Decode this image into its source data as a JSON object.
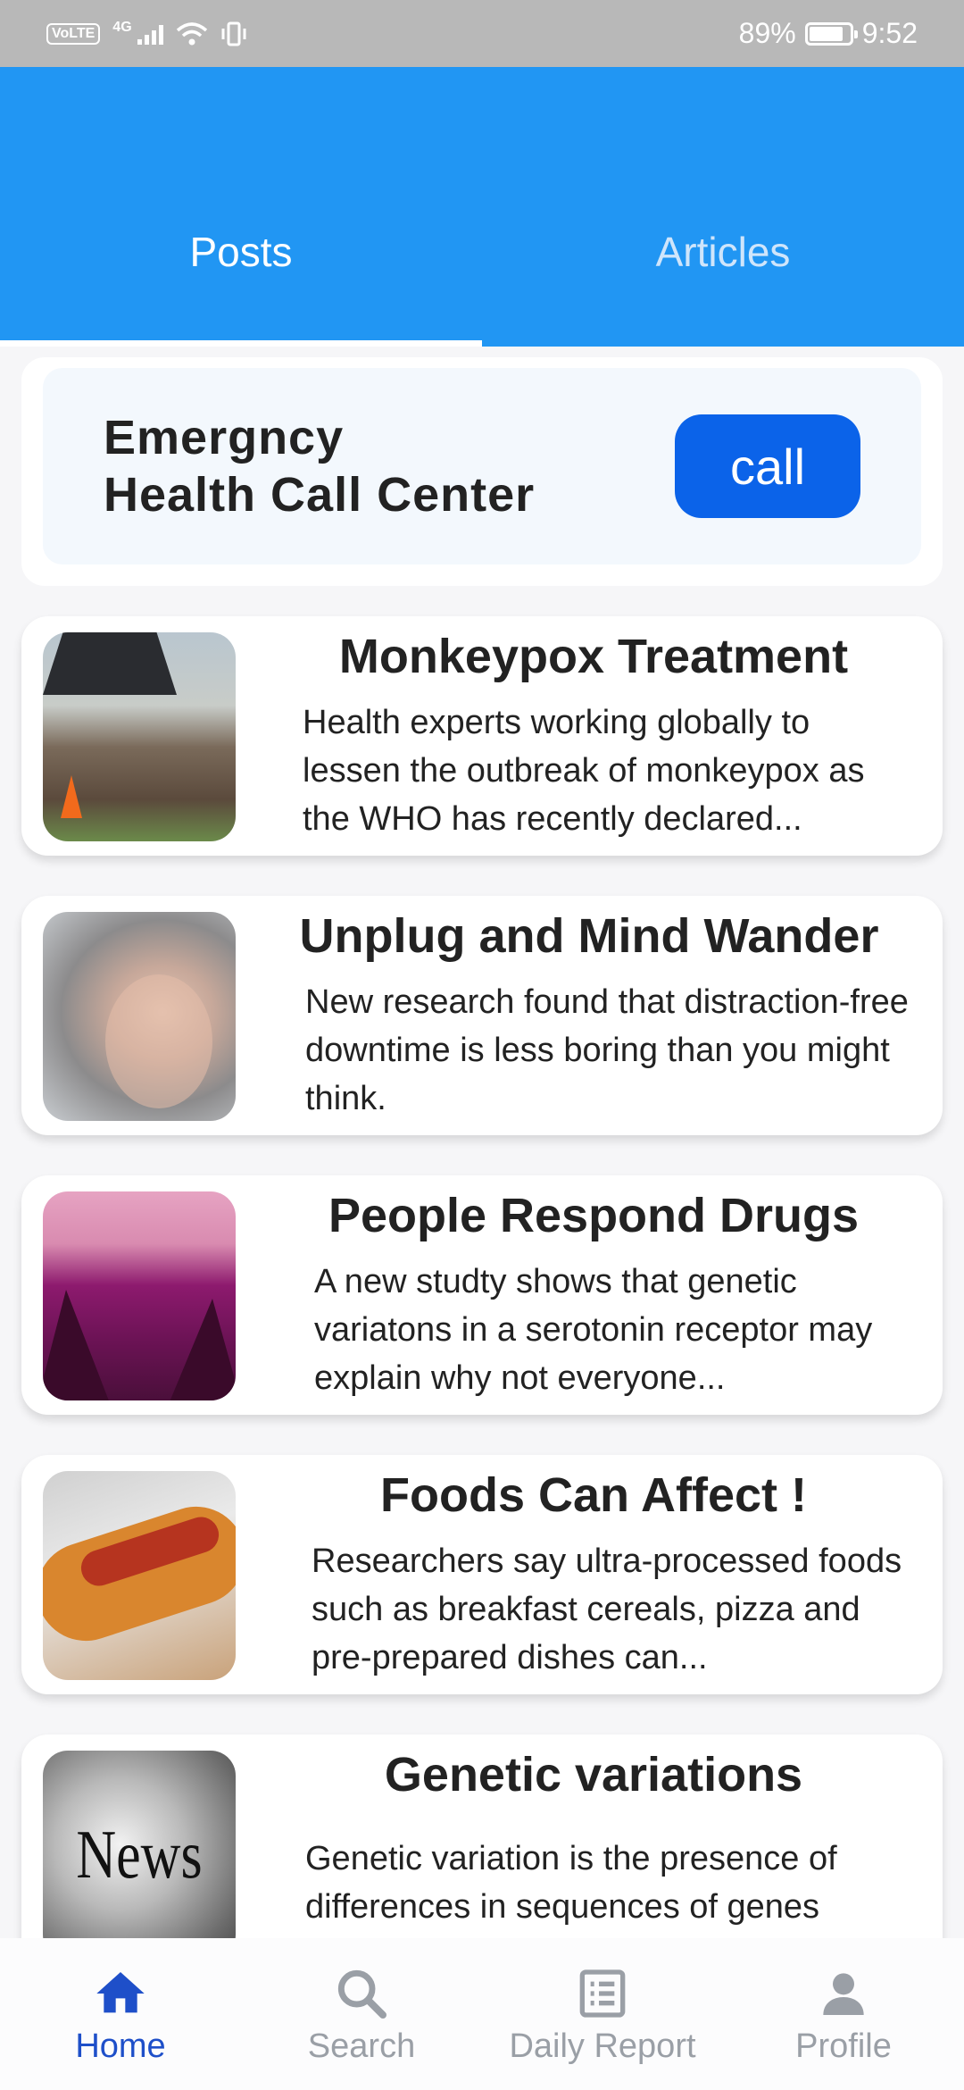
{
  "status_bar": {
    "volte": "VoLTE",
    "network": "4G",
    "battery": "89%",
    "time": "9:52",
    "battery_level": 0.89
  },
  "tabs": [
    {
      "label": "Posts",
      "active": true
    },
    {
      "label": "Articles",
      "active": false
    }
  ],
  "emergency": {
    "title_line1": "Emergncy",
    "title_line2": "Health Call Center",
    "button": "call"
  },
  "posts": [
    {
      "title": "Monkeypox Treatment",
      "body": "Health experts working globally to lessen the outbreak of monkeypox as the WHO has recently declared...",
      "image": "outdoor-tent-scene"
    },
    {
      "title": "Unplug and Mind Wander",
      "body": "New research found that distraction-free downtime is less boring than you might think.",
      "image": "woman-thinking"
    },
    {
      "title": "People Respond Drugs",
      "body": "A new studty shows that genetic variatons in a serotonin receptor may explain why not everyone...",
      "image": "pink-landscape"
    },
    {
      "title": "Foods Can Affect !",
      "body": "Researchers say ultra-processed foods such as breakfast cereals, pizza and pre-prepared dishes can...",
      "image": "hot-dog"
    },
    {
      "title": "Genetic variations",
      "body": "Genetic variation is the presence of differences in sequences of genes",
      "image": "news-logo",
      "image_text": "News"
    }
  ],
  "bottom_nav": [
    {
      "label": "Home",
      "icon": "home-icon",
      "active": true
    },
    {
      "label": "Search",
      "icon": "search-icon",
      "active": false
    },
    {
      "label": "Daily Report",
      "icon": "report-icon",
      "active": false
    },
    {
      "label": "Profile",
      "icon": "profile-icon",
      "active": false
    }
  ],
  "colors": {
    "primary": "#2196f3",
    "call_button": "#0b63e9",
    "nav_active": "#1e4fc9",
    "nav_inactive": "#9a9fa6"
  }
}
